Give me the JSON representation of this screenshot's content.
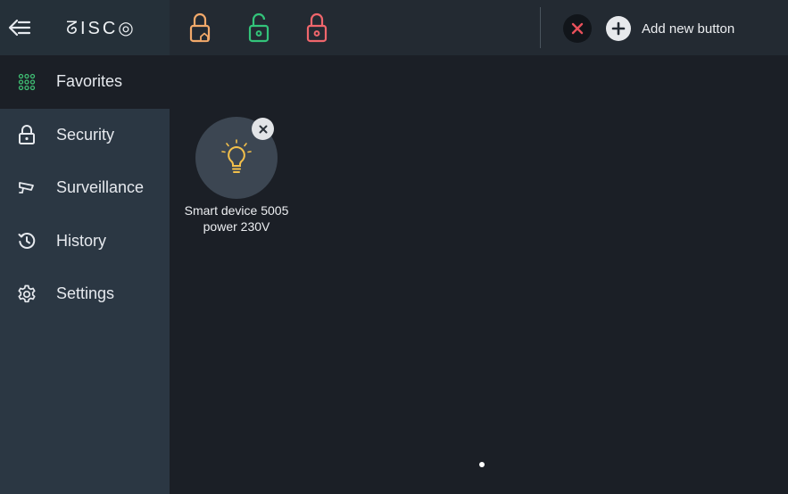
{
  "header": {
    "logo_text": "ᘔISC◎",
    "back_icon": "arrow-left-icon",
    "lock_icons": [
      {
        "name": "partial-arm-lock-icon",
        "color": "#f2a96a"
      },
      {
        "name": "disarmed-lock-icon",
        "color": "#33c47a"
      },
      {
        "name": "armed-lock-icon",
        "color": "#f0666c"
      }
    ],
    "close_icon_color": "#e8505b",
    "add_button_label": "Add new button"
  },
  "sidebar": {
    "items": [
      {
        "label": "Favorites",
        "icon": "grid-icon",
        "active": true,
        "icon_color": "#3fbf74"
      },
      {
        "label": "Security",
        "icon": "lock-icon",
        "active": false
      },
      {
        "label": "Surveillance",
        "icon": "camera-icon",
        "active": false
      },
      {
        "label": "History",
        "icon": "history-icon",
        "active": false
      },
      {
        "label": "Settings",
        "icon": "gear-icon",
        "active": false
      }
    ]
  },
  "main": {
    "favorites": [
      {
        "label_line1": "Smart device 5005",
        "label_line2": "power 230V",
        "icon": "light-bulb-icon",
        "icon_color": "#f3c04b"
      }
    ],
    "page_indicator": {
      "pages": 1,
      "current": 1
    }
  }
}
